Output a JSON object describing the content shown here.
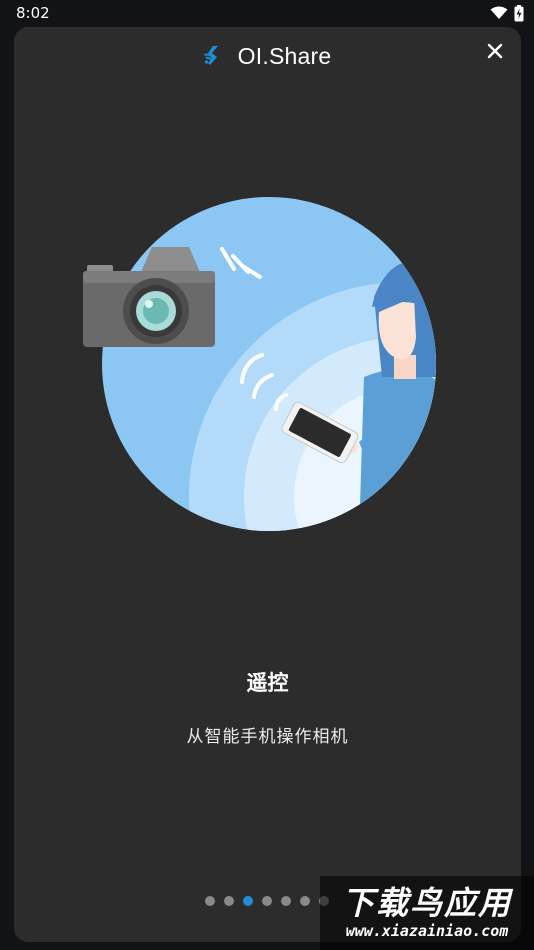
{
  "status_bar": {
    "time": "8:02",
    "icons": [
      "wifi-icon",
      "battery-charging-icon"
    ]
  },
  "header": {
    "app_title": "OI.Share",
    "logo_icon": "oi-share-logo-icon",
    "close_icon": "close-icon"
  },
  "slide": {
    "title": "遥控",
    "subtitle": "从智能手机操作相机",
    "illustration": "camera-remote-control-illustration"
  },
  "pager": {
    "total": 7,
    "active_index": 2
  },
  "watermark": {
    "title": "下载鸟应用",
    "url": "www.xiazainiao.com"
  },
  "colors": {
    "background": "#121317",
    "card": "#2c2c2c",
    "accent": "#1e8fd6",
    "circle": "#8cc7f4"
  }
}
